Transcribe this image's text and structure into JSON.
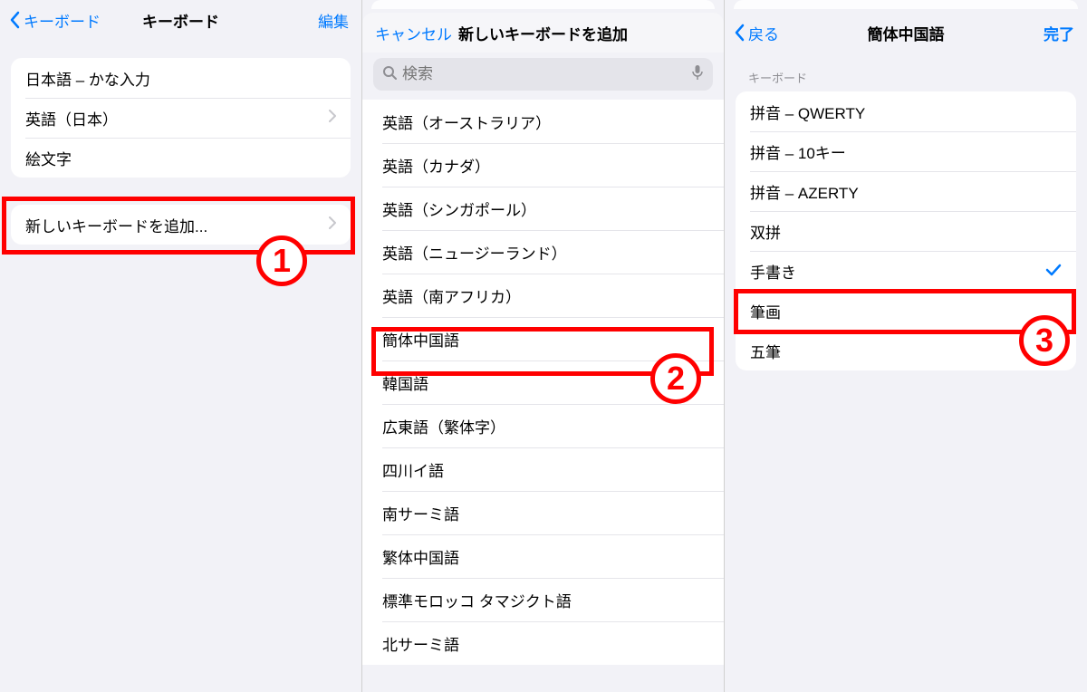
{
  "pane1": {
    "nav": {
      "back": "キーボード",
      "title": "キーボード",
      "edit": "編集"
    },
    "rows": [
      {
        "label": "日本語 – かな入力",
        "disclosure": false
      },
      {
        "label": "英語（日本）",
        "disclosure": true
      },
      {
        "label": "絵文字",
        "disclosure": false
      }
    ],
    "add_row": {
      "label": "新しいキーボードを追加...",
      "disclosure": true
    }
  },
  "pane2": {
    "cancel": "キャンセル",
    "title": "新しいキーボードを追加",
    "search_placeholder": "検索",
    "rows": [
      "英語（オーストラリア）",
      "英語（カナダ）",
      "英語（シンガポール）",
      "英語（ニュージーランド）",
      "英語（南アフリカ）",
      "簡体中国語",
      "韓国語",
      "広東語（繁体字）",
      "四川イ語",
      "南サーミ語",
      "繁体中国語",
      "標準モロッコ タマジクト語",
      "北サーミ語"
    ]
  },
  "pane3": {
    "nav": {
      "back": "戻る",
      "title": "簡体中国語",
      "done": "完了"
    },
    "section_header": "キーボード",
    "rows": [
      {
        "label": "拼音 – QWERTY",
        "checked": false
      },
      {
        "label": "拼音 – 10キー",
        "checked": false
      },
      {
        "label": "拼音 – AZERTY",
        "checked": false
      },
      {
        "label": "双拼",
        "checked": false
      },
      {
        "label": "手書き",
        "checked": true
      },
      {
        "label": "筆画",
        "checked": false
      },
      {
        "label": "五筆",
        "checked": false
      }
    ]
  },
  "annotations": {
    "n1": "1",
    "n2": "2",
    "n3": "3"
  }
}
